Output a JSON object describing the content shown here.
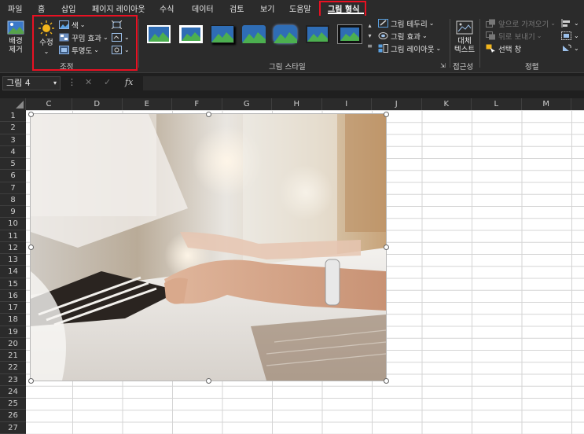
{
  "menu": {
    "tabs": [
      "파일",
      "홈",
      "삽입",
      "페이지 레이아웃",
      "수식",
      "데이터",
      "검토",
      "보기",
      "도움말",
      "그림 형식"
    ],
    "active_tab": "그림 형식"
  },
  "ribbon": {
    "remove_background": {
      "line1": "배경",
      "line2": "제거"
    },
    "adjust": {
      "corrections": "수정",
      "color": "색",
      "artistic_effects": "꾸밈 효과",
      "transparency": "투명도",
      "group_label": "조정"
    },
    "picture_styles": {
      "picture_border": "그림 테두리",
      "picture_effects": "그림 효과",
      "picture_layout": "그림 레이아웃",
      "group_label": "그림 스타일"
    },
    "accessibility": {
      "alt_text_line1": "대체",
      "alt_text_line2": "텍스트",
      "group_label": "접근성"
    },
    "arrange": {
      "bring_forward": "앞으로 가져오기",
      "send_backward": "뒤로 보내기",
      "selection_pane": "선택 창",
      "group_label": "정렬"
    }
  },
  "formula_bar": {
    "name_box": "그림 4",
    "fx_label": "fx"
  },
  "sheet": {
    "columns": [
      "C",
      "D",
      "E",
      "F",
      "G",
      "H",
      "I",
      "J",
      "K",
      "L",
      "M"
    ],
    "rows": [
      "1",
      "2",
      "3",
      "4",
      "5",
      "6",
      "7",
      "8",
      "9",
      "10",
      "11",
      "12",
      "13",
      "14",
      "15",
      "16",
      "17",
      "18",
      "19",
      "20",
      "21",
      "22",
      "23",
      "24",
      "25",
      "26",
      "27"
    ]
  },
  "colors": {
    "highlight_red": "#e81123",
    "ribbon_bg": "#2b2b2b",
    "sheet_bg": "#ffffff"
  }
}
